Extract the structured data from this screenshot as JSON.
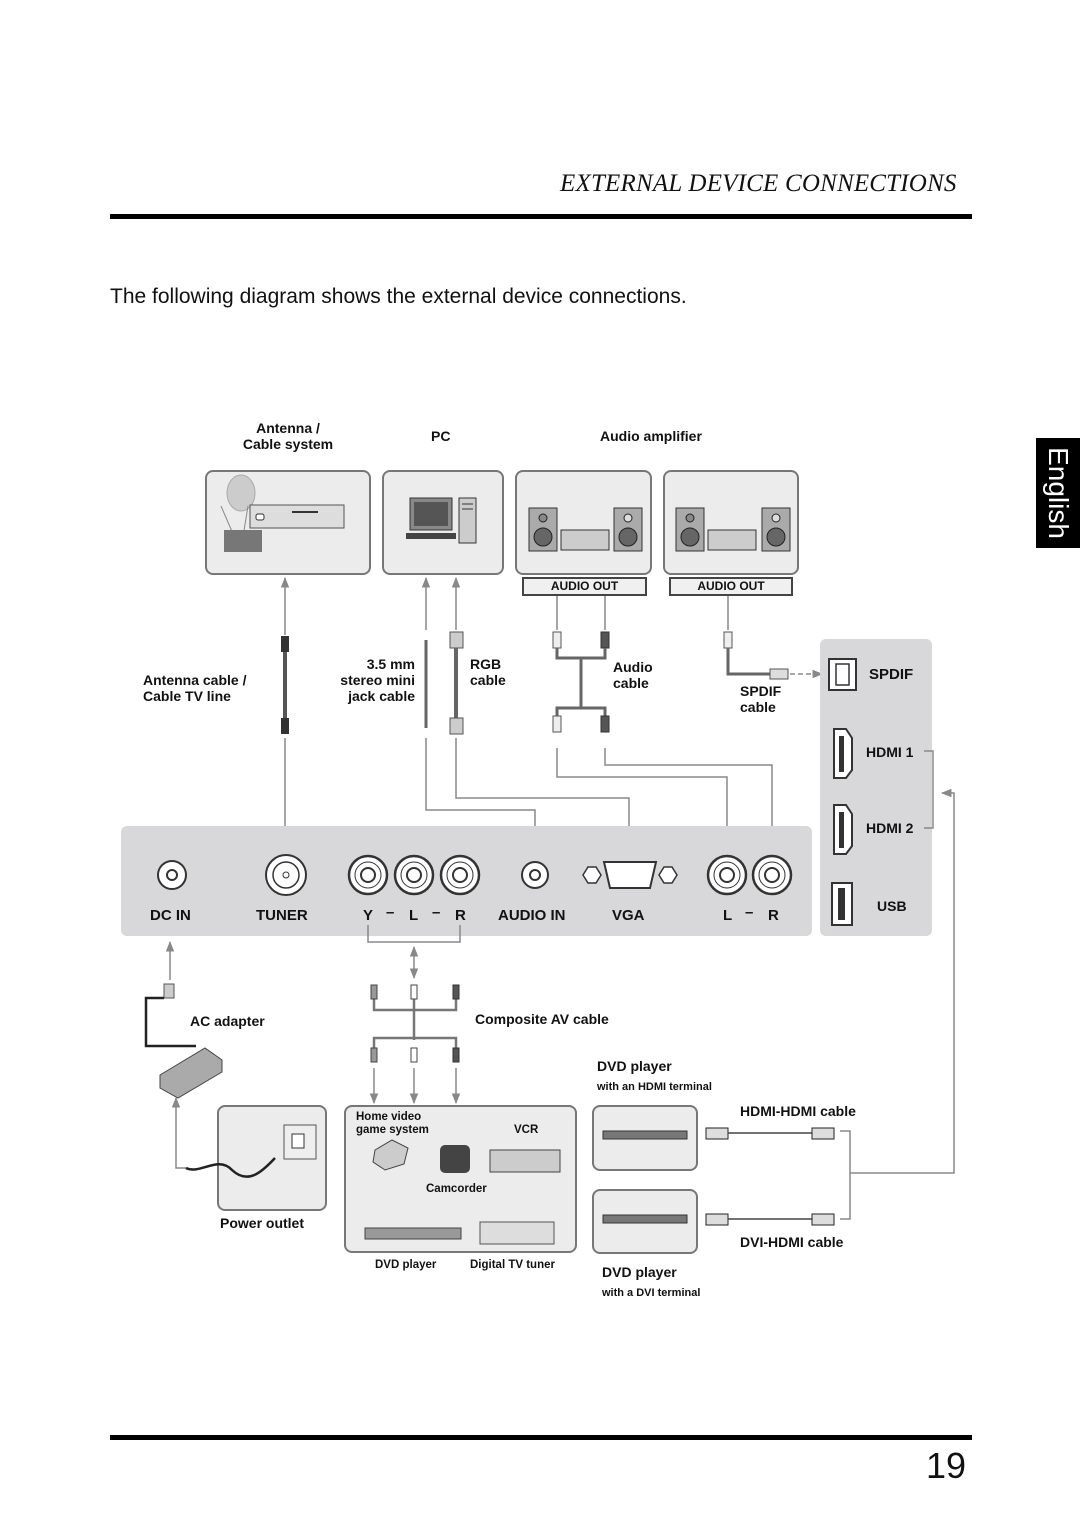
{
  "header": {
    "section_title": "EXTERNAL DEVICE CONNECTIONS",
    "intro": "The following diagram shows the external device connections."
  },
  "side_tab": {
    "language": "English"
  },
  "footer": {
    "page_number": "19"
  },
  "devices_top": {
    "antenna": {
      "label_line1": "Antenna /",
      "label_line2": "Cable system"
    },
    "pc": {
      "label": "PC"
    },
    "audio_amplifier": {
      "label": "Audio amplifier",
      "out_labels": [
        "AUDIO OUT",
        "AUDIO OUT"
      ]
    }
  },
  "cables_top": {
    "antenna_cable": {
      "line1": "Antenna cable /",
      "line2": "Cable TV line"
    },
    "mini_jack": {
      "line1": "3.5 mm",
      "line2": "stereo mini",
      "line3": "jack cable"
    },
    "rgb": {
      "line1": "RGB",
      "line2": "cable"
    },
    "audio": {
      "line1": "Audio",
      "line2": "cable"
    },
    "spdif": {
      "line1": "SPDIF",
      "line2": "cable"
    }
  },
  "tv_panel": {
    "bottom_ports": [
      "DC IN",
      "TUNER",
      "Y",
      "L",
      "R",
      "AUDIO IN",
      "VGA",
      "L",
      "R"
    ],
    "separator": "–",
    "side_ports": [
      "SPDIF",
      "HDMI 1",
      "HDMI 2",
      "USB"
    ]
  },
  "bottom": {
    "ac_adapter": "AC adapter",
    "power_outlet": "Power outlet",
    "composite_cable": "Composite AV cable",
    "av_devices": {
      "game": {
        "line1": "Home video",
        "line2": "game system"
      },
      "vcr": "VCR",
      "camcorder": "Camcorder",
      "dvd": "DVD player",
      "digital_tuner": "Digital TV tuner"
    },
    "dvd_hdmi": {
      "title": "DVD player",
      "sub": "with an HDMI terminal",
      "cable": "HDMI-HDMI cable"
    },
    "dvd_dvi": {
      "title": "DVD player",
      "sub": "with a DVI terminal",
      "cable": "DVI-HDMI cable"
    }
  },
  "colors": {
    "panel": "#d8d8da",
    "box_fill": "#ececec",
    "box_border": "#777777",
    "line": "#888888",
    "text": "#111111"
  }
}
